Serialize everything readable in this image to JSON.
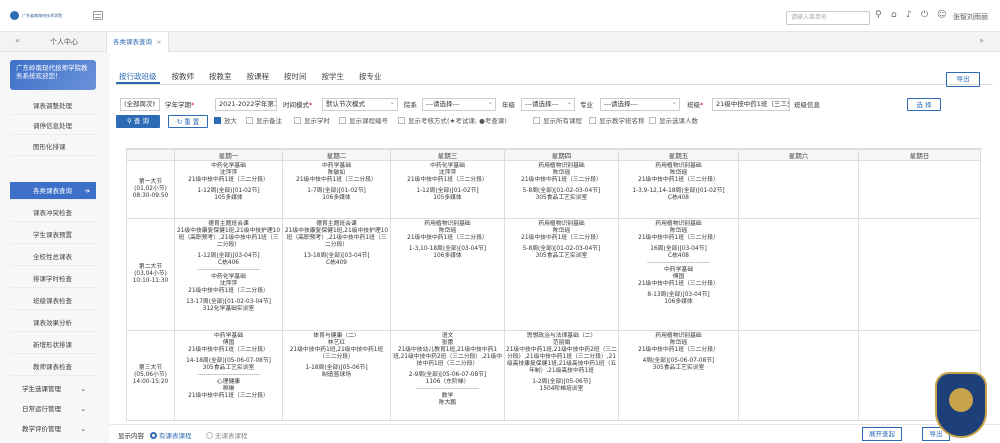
{
  "header": {
    "logo_text": "广东省南海市技术学院",
    "search_placeholder": "请输入菜单名",
    "user_name": "张智刘雨丽"
  },
  "tabs": {
    "home": "个人中心",
    "active": "各类课表查询",
    "close": "×",
    "prev": "«",
    "next": "»"
  },
  "sidebar": {
    "school": "广东岭南现代技师学院教务系统欢迎您！",
    "items": [
      "课表调整处理",
      "调停信息处理",
      "图形化排课",
      "各类课表查询",
      "课表冲突检查",
      "学生课表预置",
      "全校性总课表",
      "排课学时检查",
      "班级课表检查",
      "课表效果分析",
      "新增形状排课",
      "教师课表检查"
    ],
    "groups": [
      "学生选课管理",
      "日常运行管理",
      "教学评价管理"
    ],
    "active_index": 3,
    "arrow": "➔",
    "group_arrow": "⌄"
  },
  "query_tabs": [
    "按行政班级",
    "按教师",
    "按教室",
    "按课程",
    "按时间",
    "按学生",
    "按专业"
  ],
  "export_label": "导出",
  "filters": {
    "term_sel": "(全部周次)",
    "term_label": "学年学期",
    "term_value": "2021-2022学年第二学期",
    "time_label": "时间模式",
    "time_value": "默认节次模式",
    "campus_label": "院系",
    "campus_value": "---请选择---",
    "grade_label": "年级",
    "grade_value": "---请选择---",
    "major_label": "专业",
    "major_value": "---请选择---",
    "class_label": "班级",
    "class_value": "21级中技中药1班（三二分段）",
    "class_info_label": "班级信息",
    "select_btn": "选 择",
    "required": "*"
  },
  "actions": {
    "query": "查 询",
    "reset": "重 置",
    "checkboxes": [
      "放大",
      "显示备注",
      "显示学时",
      "显示课程编号",
      "显示考核方式(★考试课; ●考查课)",
      "显示所有课程",
      "显示教学班名称",
      "显示选课人数"
    ]
  },
  "table": {
    "headers": [
      "星期一",
      "星期二",
      "星期三",
      "星期四",
      "星期五",
      "星期六",
      "星期日"
    ],
    "rows": [
      {
        "slot": [
          "第一大节",
          "(01,02小节)",
          "08:30-09:50"
        ],
        "cells": [
          [
            "中药化学基础",
            "沈萍萍",
            "21级中技中药1班（三二分段）",
            "",
            "1-12周(全部)[01-02节]",
            "105多媒体"
          ],
          [
            "中药学基础",
            "陈敏如",
            "21级中技中药1班（三二分段）",
            "",
            "1-7周(全部)[01-02节]",
            "106多媒体"
          ],
          [
            "中药化学基础",
            "沈萍萍",
            "21级中技中药1班（三二分段）",
            "",
            "1-12周(全部)[01-02节]",
            "105多媒体"
          ],
          [
            "药用植物识别基础",
            "陈岱瑶",
            "21级中技中药1班（三二分段）",
            "",
            "5-8周(全部)[01-02-03-04节]",
            "305食品工艺实训室"
          ],
          [
            "药用植物识别基础",
            "陈岱瑶",
            "21级中技中药1班（三二分段）",
            "",
            "1-3,9-12,14-18周(全部)[01-02节]",
            "C栋408"
          ],
          [],
          []
        ]
      },
      {
        "slot": [
          "第二大节",
          "(03,04小节)",
          "10:10-11:30"
        ],
        "cells": [
          [
            "德育主题班会课",
            "21级中技康复保健1班,21级中技护理10班（高职预考）,21级中技中药1班（三二分段）",
            "",
            "1-12周(全部)[03-04节]",
            "C栋406",
            "------------------------------",
            "中药化学基础",
            "沈萍萍",
            "21级中技中药1班（三二分段）",
            "",
            "13-17周(全部)[01-02-03-04节]",
            "312化学基础实训室"
          ],
          [
            "德育主题班会课",
            "21级中技康复保健1班,21级中技护理10班（高职预考）,21级中技中药1班（三二分段）",
            "",
            "13-18周(全部)[03-04节]",
            "C栋409"
          ],
          [
            "药用植物识别基础",
            "陈岱瑶",
            "21级中技中药1班（三二分段）",
            "",
            "1-3,10-18周(全部)[03-04节]",
            "106多媒体"
          ],
          [
            "药用植物识别基础",
            "陈岱瑶",
            "21级中技中药1班（三二分段）",
            "",
            "5-8周(全部)[01-02-03-04节]",
            "305食品工艺实训室"
          ],
          [
            "药用植物识别基础",
            "陈岱瑶",
            "21级中技中药1班（三二分段）",
            "",
            "16周(全部)[03-04节]",
            "C栋408",
            "------------------------------",
            "中药学基础",
            "傅国",
            "21级中技中药1班（三二分段）",
            "",
            "8-13周(全部)[03-04节]",
            "106多媒体"
          ],
          [],
          []
        ]
      },
      {
        "slot": [
          "第三大节",
          "(05,06小节)",
          "14:00-15:20"
        ],
        "cells": [
          [
            "中药学基础",
            "傅国",
            "21级中技中药1班（三二分段）",
            "",
            "14-18周(全部)[05-06-07-08节]",
            "305食品工艺实训室",
            "------------------------------",
            "心理健康",
            "穆琳",
            "21级中技中药1班（三二分段）"
          ],
          [
            "体育与健康（二）",
            "林艺红",
            "21级中技中药1班,21级中技中药1班（三二分段）",
            "",
            "1-18周(全部)[05-06节]",
            "制造篮球场"
          ],
          [
            "语文",
            "张蕾",
            "21级中技幼儿教育1班,21级中技中药1班,21级中技中药2班（三二分段）,21级中技中药1班（三二分段）",
            "",
            "2-9周(全部)[05-06-07-08节]",
            "1106（东阶梯）",
            "------------------------------",
            "数学",
            "陈大鹏"
          ],
          [
            "思想政治与法律基础（二）",
            "范丽娟",
            "21级中技中药1班,21级中技中药2班（三二分段）,21级中技中药1班（三二分段）,21级高技康复保健1班,21级高技中药1班（五年制）,21级高技中药1班",
            "",
            "1-2周(全部)[05-06节]",
            "1504阶梯培训室"
          ],
          [
            "药用植物识别基础",
            "陈岱瑶",
            "21级中技中药1班（三二分段）",
            "",
            "4周(全部)[05-06-07-08节]",
            "305食品工艺实训室"
          ],
          [],
          []
        ]
      }
    ]
  },
  "bottom": {
    "display_label": "显示内容",
    "opt1": "有课表课程",
    "opt2": "无课表课程",
    "btn1": "展开查起",
    "btn2": "导出"
  }
}
